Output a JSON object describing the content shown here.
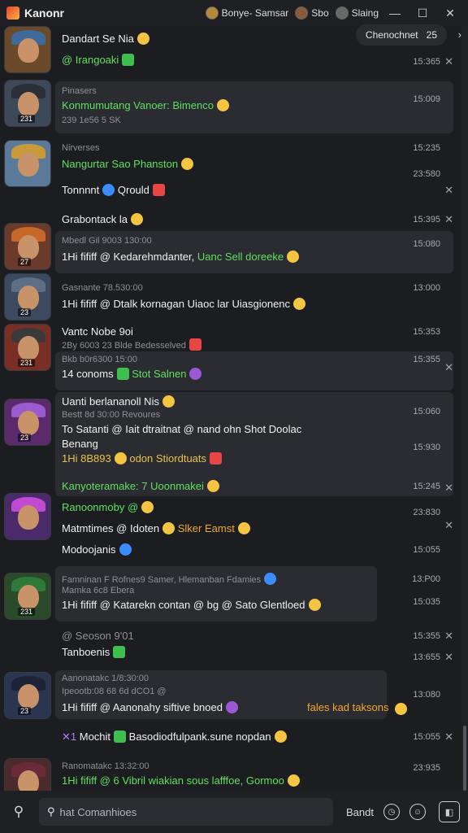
{
  "titlebar": {
    "app_title": "Kanonr",
    "profile_1": "Bonye- Samsar",
    "profile_2": "Sbo",
    "profile_3": "Slaing",
    "minimize": "—",
    "maximize": "☐",
    "close": "✕"
  },
  "filter_chip": {
    "label": "Chenochnet",
    "count": "25",
    "arrow": "›"
  },
  "items": [
    {
      "line1": "Dandart Se Nia",
      "line2": "@ Irangoaki",
      "time": "15:365"
    },
    {
      "sub1": "Pinasers",
      "line1": "Konmumutang Vanoer: Bimenco",
      "sub2": "239 1e56 5 SK",
      "time": "15:009"
    },
    {
      "sub1": "Nirverses",
      "line1": "Nangurtar Sao Phanston",
      "line2": "Tonnnnt",
      "line2b": "Qrould",
      "time": "15:235",
      "time2": "23:580"
    },
    {
      "line1": "Grabontack la",
      "time": "15:395"
    },
    {
      "sub1": "Mbedl Gil 9003  130:00",
      "line1": "1Hi fififf @ Kedarehmdanter,",
      "line1b": "Uanc Sell doreeke",
      "time": "15:080"
    },
    {
      "sub1": "Gasnante  78.530:00",
      "line1": "1Hi fififf @ Dtalk kornagan Uiaoc lar Uiasgionenc",
      "time": "13:000"
    },
    {
      "line1": "Vantc Nobe 9oi",
      "sub1": "2By 6003 23  Blde Bedesselved",
      "time": "15:353"
    },
    {
      "sub1": "Bkb b0r6300 15:00",
      "line1": "14 conoms",
      "line1b": "Stot Salnen",
      "time": "15:355"
    },
    {
      "line1": "Uanti berlananoll Nis",
      "sub1": "Bestt 8d 30:00  Revoures",
      "line2": "To Satanti @ Iait dtraitnat @ nand ohn Shot Doolac",
      "line3": "Benang",
      "line4": "1Hi 8B893",
      "line4b": "odon Stiordtuats",
      "time": "15:060",
      "time2": "15:930"
    },
    {
      "line1": "Kanyoteramake: 7 Uoonmakei",
      "line2": "Ranoonmoby @",
      "line3": "Matmtimes @ Idoten",
      "line3b": "Slker Eamst",
      "line4": "Modoojanis",
      "time": "15:245",
      "time2": "23:830",
      "time3": "15:055"
    },
    {
      "sub1": "Famninan  F Rofnes9 Samer, Hlemanban Fdamies",
      "sub2": "Mamka 6c8 Ebera",
      "line1": "1Hi fififf @ Katarekn contan @ bg @ Sato Glentloed",
      "time": "13:P00",
      "time2": "15:035"
    },
    {
      "line1": "@ Seoson  9'01",
      "line2": "Tanboenis",
      "time": "15:355",
      "time2": "13:655"
    },
    {
      "sub1": "Aanonatakc  1/8:30:00",
      "sub2": "Ipeootb:08 68 6d dCO1 @",
      "line1": "1Hi fififf @ Aanonahy siftive bnoed",
      "line1b": "fales kad taksons",
      "time": "13:080"
    },
    {
      "line1": "Mochit",
      "line1b": "Basodiodfulpank.sune nopdan",
      "time": "15:055"
    },
    {
      "sub1": "Ranomatakc  13:32:00",
      "line1": "1Hi fififf @ 6 Vibril wiakian sous lafffoe, Gormoo",
      "time": "23:935"
    }
  ],
  "composer": {
    "search_placeholder": "hat Comanhioes",
    "send_label": "Bandt"
  },
  "colors": {
    "accent": "#5ee05e",
    "background": "#1c1d21",
    "card": "#2b2c31"
  }
}
